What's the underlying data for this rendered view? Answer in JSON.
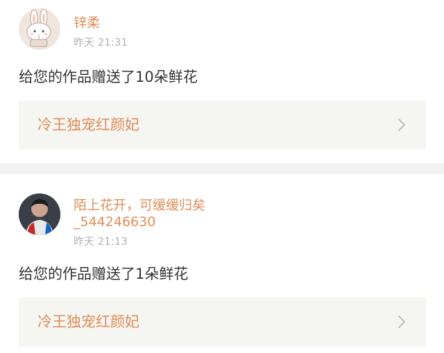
{
  "notifications": [
    {
      "name": "锌柔",
      "time": "昨天 21:31",
      "message": "给您的作品赠送了10朵鲜花",
      "work_title": "冷王独宠红颜妃",
      "avatar_icon": "cartoon-rabbit-avatar"
    },
    {
      "name_line1": "陌上花开，可缓缓归矣",
      "name_line2": "_544246630",
      "time": "昨天 21:13",
      "message": "给您的作品赠送了1朵鲜花",
      "work_title": "冷王独宠红颜妃",
      "avatar_icon": "person-photo-avatar"
    }
  ],
  "colors": {
    "accent": "#e08d58",
    "text": "#333333",
    "muted": "#b3b3b3",
    "box": "#f5f5f2",
    "divider": "#f2f2f2"
  }
}
